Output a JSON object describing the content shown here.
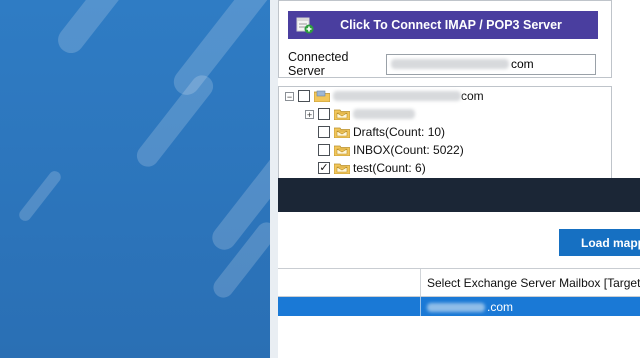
{
  "connect": {
    "button_label": "Click To Connect  IMAP / POP3 Server",
    "button_icon": "connect-server-icon",
    "server_label": "Connected Server",
    "server_value_suffix": "com"
  },
  "tree": {
    "root": {
      "suffix": "com",
      "expander": "−",
      "checked": false
    },
    "nodes": [
      {
        "label": "",
        "checked": false,
        "expander": "+",
        "blurred": true
      },
      {
        "label": "Drafts(Count: 10)",
        "checked": false
      },
      {
        "label": "INBOX(Count: 5022)",
        "checked": false
      },
      {
        "label": "test(Count: 6)",
        "checked": true
      }
    ],
    "checkmark": "✓"
  },
  "load_button": {
    "label": "Load mapp"
  },
  "grid": {
    "column_target": "Select Exchange Server Mailbox [Target]",
    "row": {
      "suffix": ".com",
      "selected": true
    }
  },
  "colors": {
    "connect_button": "#4a3e9f",
    "load_button": "#1670c2",
    "selected_row": "#1a79d6",
    "dark_bar": "#1b2636",
    "left_background": "#2f7cc4"
  }
}
